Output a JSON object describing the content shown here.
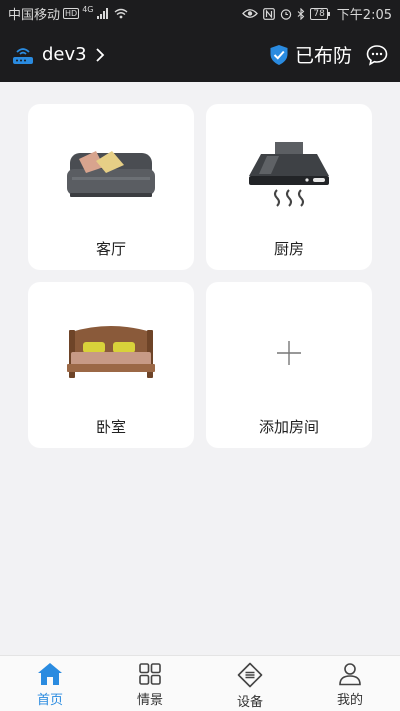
{
  "status_bar": {
    "carrier": "中国移动",
    "hd_badge": "HD",
    "network": "4G",
    "battery": "78",
    "time": "下午2:05",
    "icons": [
      "eye-icon",
      "nfc-icon",
      "alarm-icon",
      "bluetooth-icon",
      "wifi-icon",
      "signal-icon"
    ]
  },
  "header": {
    "device_name": "dev3",
    "security_status": "已布防",
    "accent_color": "#2a8be0"
  },
  "rooms": [
    {
      "label": "客厅",
      "icon": "sofa-icon"
    },
    {
      "label": "厨房",
      "icon": "range-hood-icon"
    },
    {
      "label": "卧室",
      "icon": "bed-icon"
    },
    {
      "label": "添加房间",
      "icon": "plus-icon"
    }
  ],
  "bottom_nav": [
    {
      "label": "首页",
      "icon": "home-icon",
      "active": true
    },
    {
      "label": "情景",
      "icon": "grid-icon",
      "active": false
    },
    {
      "label": "设备",
      "icon": "device-icon",
      "active": false
    },
    {
      "label": "我的",
      "icon": "person-icon",
      "active": false
    }
  ]
}
